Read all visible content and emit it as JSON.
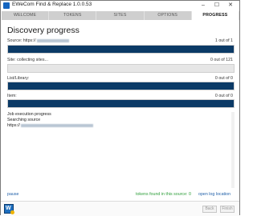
{
  "window": {
    "title": "EWeCom Find & Replace 1.0.0.53",
    "controls": {
      "minimize": "–",
      "maximize": "☐",
      "close": "✕"
    }
  },
  "tabs": [
    {
      "label": "WELCOME"
    },
    {
      "label": "TOKENS"
    },
    {
      "label": "SITES"
    },
    {
      "label": "OPTIONS"
    },
    {
      "label": "PROGRESS",
      "active": true
    }
  ],
  "heading": "Discovery progress",
  "progress": {
    "source": {
      "label": "Source: https://",
      "count": "1 out of 1",
      "fill_fraction": 1.0
    },
    "site": {
      "label": "Site: collecting sites...",
      "count": "0 out of 121",
      "fill_fraction": 0.0
    },
    "list": {
      "label": "List/Library:",
      "count": "0 out of 0",
      "fill_fraction": 1.0
    },
    "item": {
      "label": "Item:",
      "count": "0 out of 0",
      "fill_fraction": 1.0
    }
  },
  "log": {
    "line1": "Job execution progress",
    "line2": "Searching source",
    "line3": "https://"
  },
  "footer": {
    "pause": "pause",
    "tokens_found": "tokens found in this source: 0",
    "open_log": "open log location"
  },
  "buttons": {
    "back": "Back",
    "finish": "Finish"
  },
  "colors": {
    "bar_fill": "#0b3a66",
    "tab_bar": "#cfcfcf",
    "status_green": "#2e9e3a",
    "link_blue": "#1f5fa8"
  }
}
